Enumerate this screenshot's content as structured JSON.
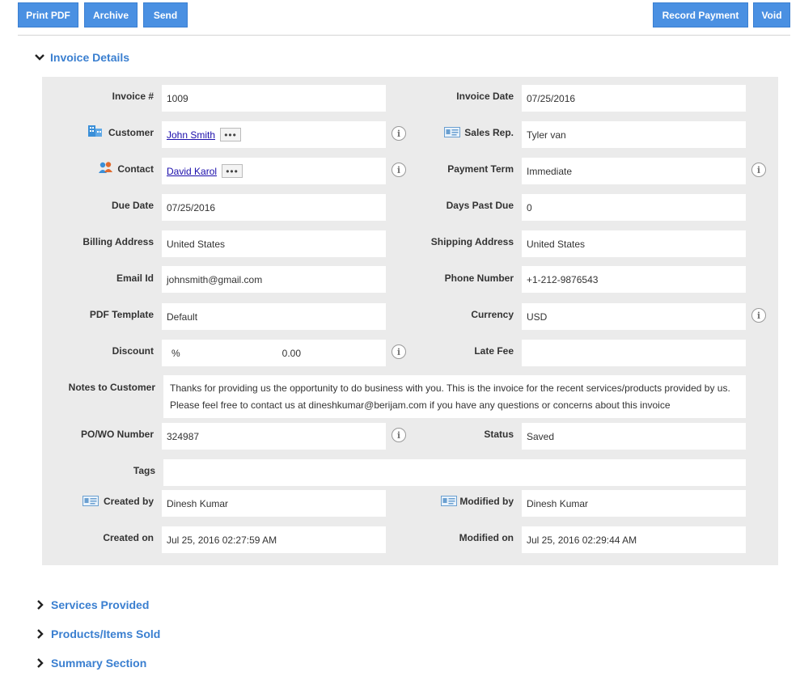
{
  "toolbar": {
    "print_pdf": "Print PDF",
    "archive": "Archive",
    "send": "Send",
    "record_payment": "Record Payment",
    "void": "Void"
  },
  "sections": {
    "invoice_details": "Invoice Details",
    "services_provided": "Services Provided",
    "products_items_sold": "Products/Items Sold",
    "summary_section": "Summary Section"
  },
  "labels": {
    "invoice_no": "Invoice #",
    "invoice_date": "Invoice Date",
    "customer": "Customer",
    "sales_rep": "Sales Rep.",
    "contact": "Contact",
    "payment_term": "Payment Term",
    "due_date": "Due Date",
    "days_past_due": "Days Past Due",
    "billing_address": "Billing Address",
    "shipping_address": "Shipping Address",
    "email_id": "Email Id",
    "phone_number": "Phone Number",
    "pdf_template": "PDF Template",
    "currency": "Currency",
    "discount": "Discount",
    "late_fee": "Late Fee",
    "notes_to_customer": "Notes to Customer",
    "po_wo_number": "PO/WO Number",
    "status": "Status",
    "tags": "Tags",
    "created_by": "Created by",
    "modified_by": "Modified by",
    "created_on": "Created on",
    "modified_on": "Modified on"
  },
  "values": {
    "invoice_no": "1009",
    "invoice_date": "07/25/2016",
    "customer": "John Smith",
    "sales_rep": "Tyler van",
    "contact": "David Karol",
    "payment_term": "Immediate",
    "due_date": "07/25/2016",
    "days_past_due": "0",
    "billing_address": "United States",
    "shipping_address": "United States",
    "email_id": "johnsmith@gmail.com",
    "phone_number": "+1-212-9876543",
    "pdf_template": "Default",
    "currency": "USD",
    "discount_unit": "%",
    "discount_value": "0.00",
    "late_fee": "",
    "notes_to_customer": "Thanks for providing us the opportunity to do business with you. This is the invoice for the recent services/products provided by us. Please feel free to contact us at dineshkumar@berijam.com if you have any questions or concerns about this invoice",
    "po_wo_number": "324987",
    "status": "Saved",
    "tags": "",
    "created_by": "Dinesh Kumar",
    "modified_by": "Dinesh Kumar",
    "created_on": "Jul 25, 2016 02:27:59 AM",
    "modified_on": "Jul 25, 2016 02:29:44 AM"
  },
  "icons": {
    "more": "•••",
    "info": "i"
  },
  "colors": {
    "accent": "#4a90e2",
    "section_title": "#3a7fd0",
    "panel_bg": "#ebebeb"
  }
}
